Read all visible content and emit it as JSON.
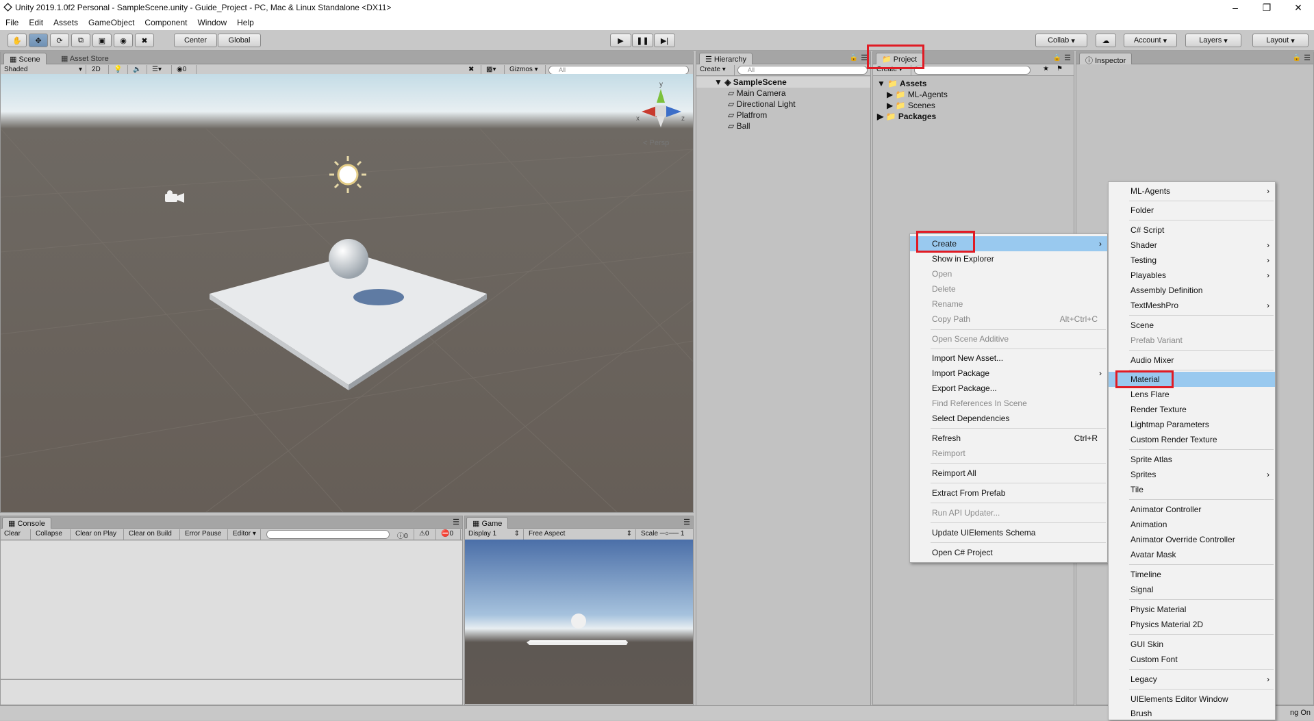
{
  "window": {
    "title": "Unity 2019.1.0f2 Personal - SampleScene.unity - Guide_Project - PC, Mac & Linux Standalone <DX11>"
  },
  "menubar": [
    "File",
    "Edit",
    "Assets",
    "GameObject",
    "Component",
    "Window",
    "Help"
  ],
  "toolbar": {
    "center": "Center",
    "global": "Global",
    "collab": "Collab",
    "account": "Account",
    "layers": "Layers",
    "layout": "Layout"
  },
  "scene": {
    "tab": "Scene",
    "tab2": "Asset Store",
    "shading": "Shaded",
    "mode2d": "2D",
    "fx": "0",
    "gizmos": "Gizmos",
    "search": "All",
    "persp": "< Persp",
    "axis_y": "y",
    "axis_x": "x",
    "axis_z": "z"
  },
  "hierarchy": {
    "tab": "Hierarchy",
    "create": "Create",
    "search": "All",
    "scene": "SampleScene",
    "items": [
      "Main Camera",
      "Directional Light",
      "Platfrom",
      "Ball"
    ]
  },
  "project": {
    "tab": "Project",
    "create": "Create",
    "items": [
      "Assets",
      "ML-Agents",
      "Scenes",
      "Packages"
    ]
  },
  "inspector": {
    "tab": "Inspector"
  },
  "console": {
    "tab": "Console",
    "buttons": [
      "Clear",
      "Collapse",
      "Clear on Play",
      "Clear on Build",
      "Error Pause",
      "Editor"
    ],
    "counts": [
      "0",
      "0",
      "0"
    ]
  },
  "game": {
    "tab": "Game",
    "display": "Display 1",
    "aspect": "Free Aspect",
    "scale": "Scale",
    "scale_val": "1"
  },
  "context_menu": {
    "items": [
      {
        "label": "Create",
        "arrow": true,
        "selected": true
      },
      {
        "label": "Show in Explorer"
      },
      {
        "label": "Open",
        "disabled": true
      },
      {
        "label": "Delete",
        "disabled": true
      },
      {
        "label": "Rename",
        "disabled": true
      },
      {
        "label": "Copy Path",
        "disabled": true,
        "shortcut": "Alt+Ctrl+C"
      },
      {
        "label": "Open Scene Additive",
        "disabled": true
      },
      {
        "label": "Import New Asset..."
      },
      {
        "label": "Import Package",
        "arrow": true
      },
      {
        "label": "Export Package..."
      },
      {
        "label": "Find References In Scene",
        "disabled": true
      },
      {
        "label": "Select Dependencies"
      },
      {
        "label": "Refresh",
        "shortcut": "Ctrl+R"
      },
      {
        "label": "Reimport",
        "disabled": true
      },
      {
        "label": "Reimport All"
      },
      {
        "label": "Extract From Prefab"
      },
      {
        "label": "Run API Updater...",
        "disabled": true
      },
      {
        "label": "Update UIElements Schema"
      },
      {
        "label": "Open C# Project"
      }
    ]
  },
  "create_submenu": {
    "items": [
      {
        "label": "ML-Agents",
        "arrow": true
      },
      {
        "label": "Folder"
      },
      {
        "label": "C# Script"
      },
      {
        "label": "Shader",
        "arrow": true
      },
      {
        "label": "Testing",
        "arrow": true
      },
      {
        "label": "Playables",
        "arrow": true
      },
      {
        "label": "Assembly Definition"
      },
      {
        "label": "TextMeshPro",
        "arrow": true
      },
      {
        "label": "Scene"
      },
      {
        "label": "Prefab Variant",
        "disabled": true
      },
      {
        "label": "Audio Mixer"
      },
      {
        "label": "Material",
        "selected": true
      },
      {
        "label": "Lens Flare"
      },
      {
        "label": "Render Texture"
      },
      {
        "label": "Lightmap Parameters"
      },
      {
        "label": "Custom Render Texture"
      },
      {
        "label": "Sprite Atlas"
      },
      {
        "label": "Sprites",
        "arrow": true
      },
      {
        "label": "Tile"
      },
      {
        "label": "Animator Controller"
      },
      {
        "label": "Animation"
      },
      {
        "label": "Animator Override Controller"
      },
      {
        "label": "Avatar Mask"
      },
      {
        "label": "Timeline"
      },
      {
        "label": "Signal"
      },
      {
        "label": "Physic Material"
      },
      {
        "label": "Physics Material 2D"
      },
      {
        "label": "GUI Skin"
      },
      {
        "label": "Custom Font"
      },
      {
        "label": "Legacy",
        "arrow": true
      },
      {
        "label": "UIElements Editor Window"
      },
      {
        "label": "Brush"
      }
    ]
  },
  "status": {
    "right": "ng On"
  },
  "colors": {
    "highlight_box": "#e01b24",
    "menu_selection": "#99c9ef"
  }
}
